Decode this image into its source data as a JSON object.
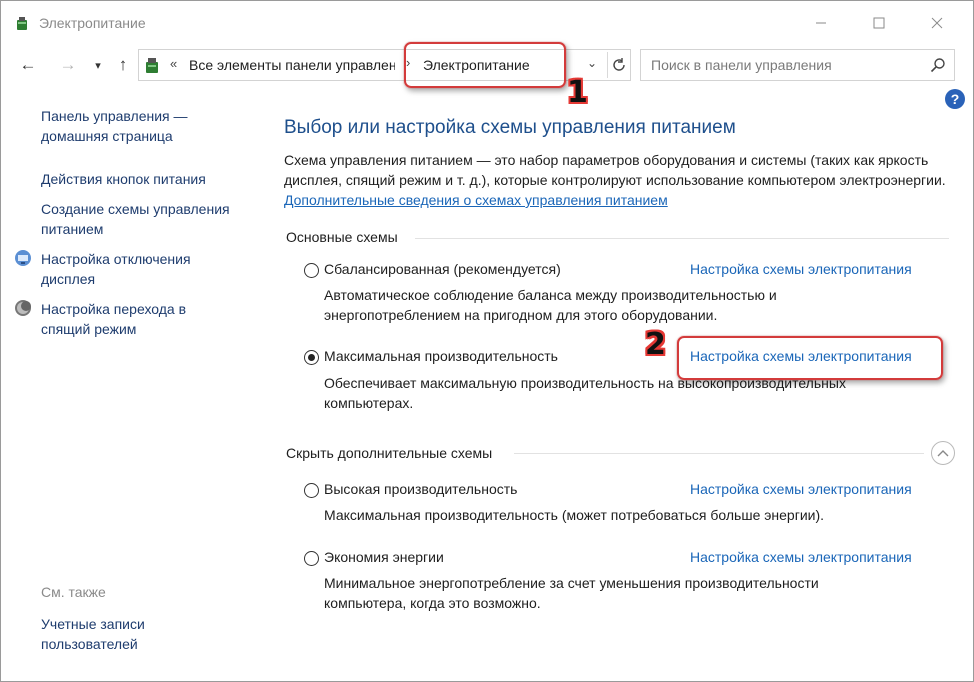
{
  "window": {
    "title": "Электропитание"
  },
  "nav": {
    "breadcrumb_overflow": "«",
    "breadcrumb_root": "Все элементы панели управления",
    "breadcrumb_current": "Электропитание",
    "search_placeholder": "Поиск в панели управления"
  },
  "annotations": {
    "badge1": "1",
    "badge2": "2",
    "accent": "#d33b3b"
  },
  "sidebar": {
    "home": "Панель управления — домашняя страница",
    "items": [
      "Действия кнопок питания",
      "Создание схемы управления питанием",
      "Настройка отключения дисплея",
      "Настройка перехода в спящий режим"
    ],
    "see_also": "См. также",
    "user_accounts": "Учетные записи пользователей"
  },
  "main": {
    "title": "Выбор или настройка схемы управления питанием",
    "description": "Схема управления питанием — это набор параметров оборудования и системы (таких как яркость дисплея, спящий режим и т. д.), которые контролируют использование компьютером электроэнергии.",
    "description_link": "Дополнительные сведения о схемах управления питанием",
    "group_main": "Основные схемы",
    "group_hidden": "Скрыть дополнительные схемы",
    "plans": [
      {
        "name": "Сбалансированная (рекомендуется)",
        "link": "Настройка схемы электропитания",
        "desc": "Автоматическое соблюдение баланса между производительностью и энергопотреблением на пригодном для этого оборудовании.",
        "selected": false
      },
      {
        "name": "Максимальная производительность",
        "link": "Настройка схемы электропитания",
        "desc": "Обеспечивает максимальную производительность на высокопроизводительных компьютерах.",
        "selected": true
      },
      {
        "name": "Высокая производительность",
        "link": "Настройка схемы электропитания",
        "desc": "Максимальная производительность (может потребоваться больше энергии).",
        "selected": false
      },
      {
        "name": "Экономия энергии",
        "link": "Настройка схемы электропитания",
        "desc": "Минимальное энергопотребление за счет уменьшения производительности компьютера, когда это возможно.",
        "selected": false
      }
    ]
  }
}
